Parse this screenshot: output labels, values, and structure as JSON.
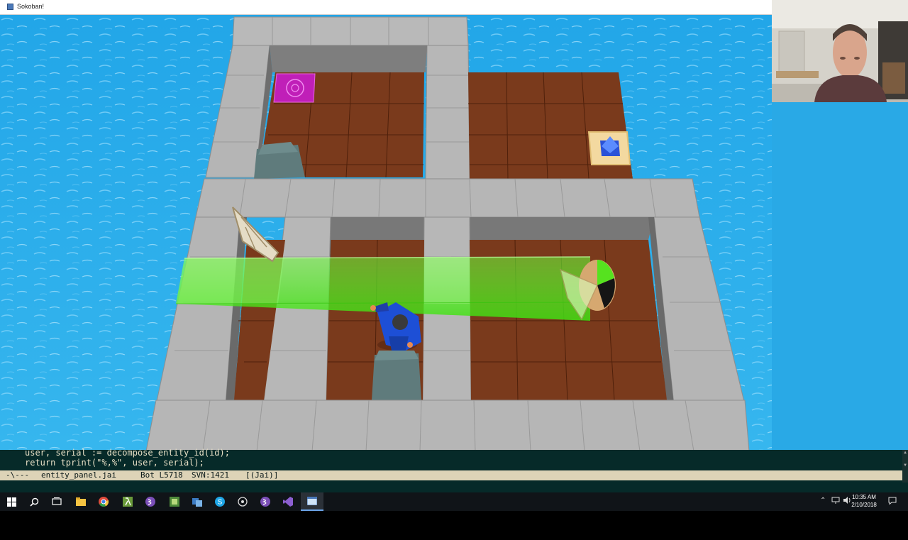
{
  "window": {
    "title": "Sokoban!"
  },
  "editor": {
    "code_lines": [
      "user, serial := decompose_entity_id(id);",
      "return tprint(\"%,%\", user, serial);"
    ],
    "modeline": {
      "status": "-\\---",
      "buffer": "entity_panel.jai",
      "position": "Bot L5718",
      "vc": "SVN:1421",
      "mode": "[(Jai)]"
    }
  },
  "taskbar": {
    "icons": [
      "windows-start-icon",
      "search-icon",
      "task-view-icon",
      "file-explorer-icon",
      "chrome-icon",
      "emacs-icon",
      "lambda-icon",
      "app-icon-1",
      "app-icon-2",
      "skype-icon",
      "settings-icon",
      "emacs-icon-2",
      "visual-studio-icon",
      "game-window-icon"
    ],
    "clock_time": "10:35 AM",
    "clock_date": "2/10/2018"
  },
  "colors": {
    "sky_water": "#29a9e6",
    "wall_top": "#b8b8b8",
    "floor": "#7a3a1c",
    "laser": "#5cff22",
    "goal_magenta": "#c01fb8",
    "player_blue": "#1d4fd6",
    "editor_bg": "#062a29",
    "modeline_bg": "#ddd3b7"
  }
}
